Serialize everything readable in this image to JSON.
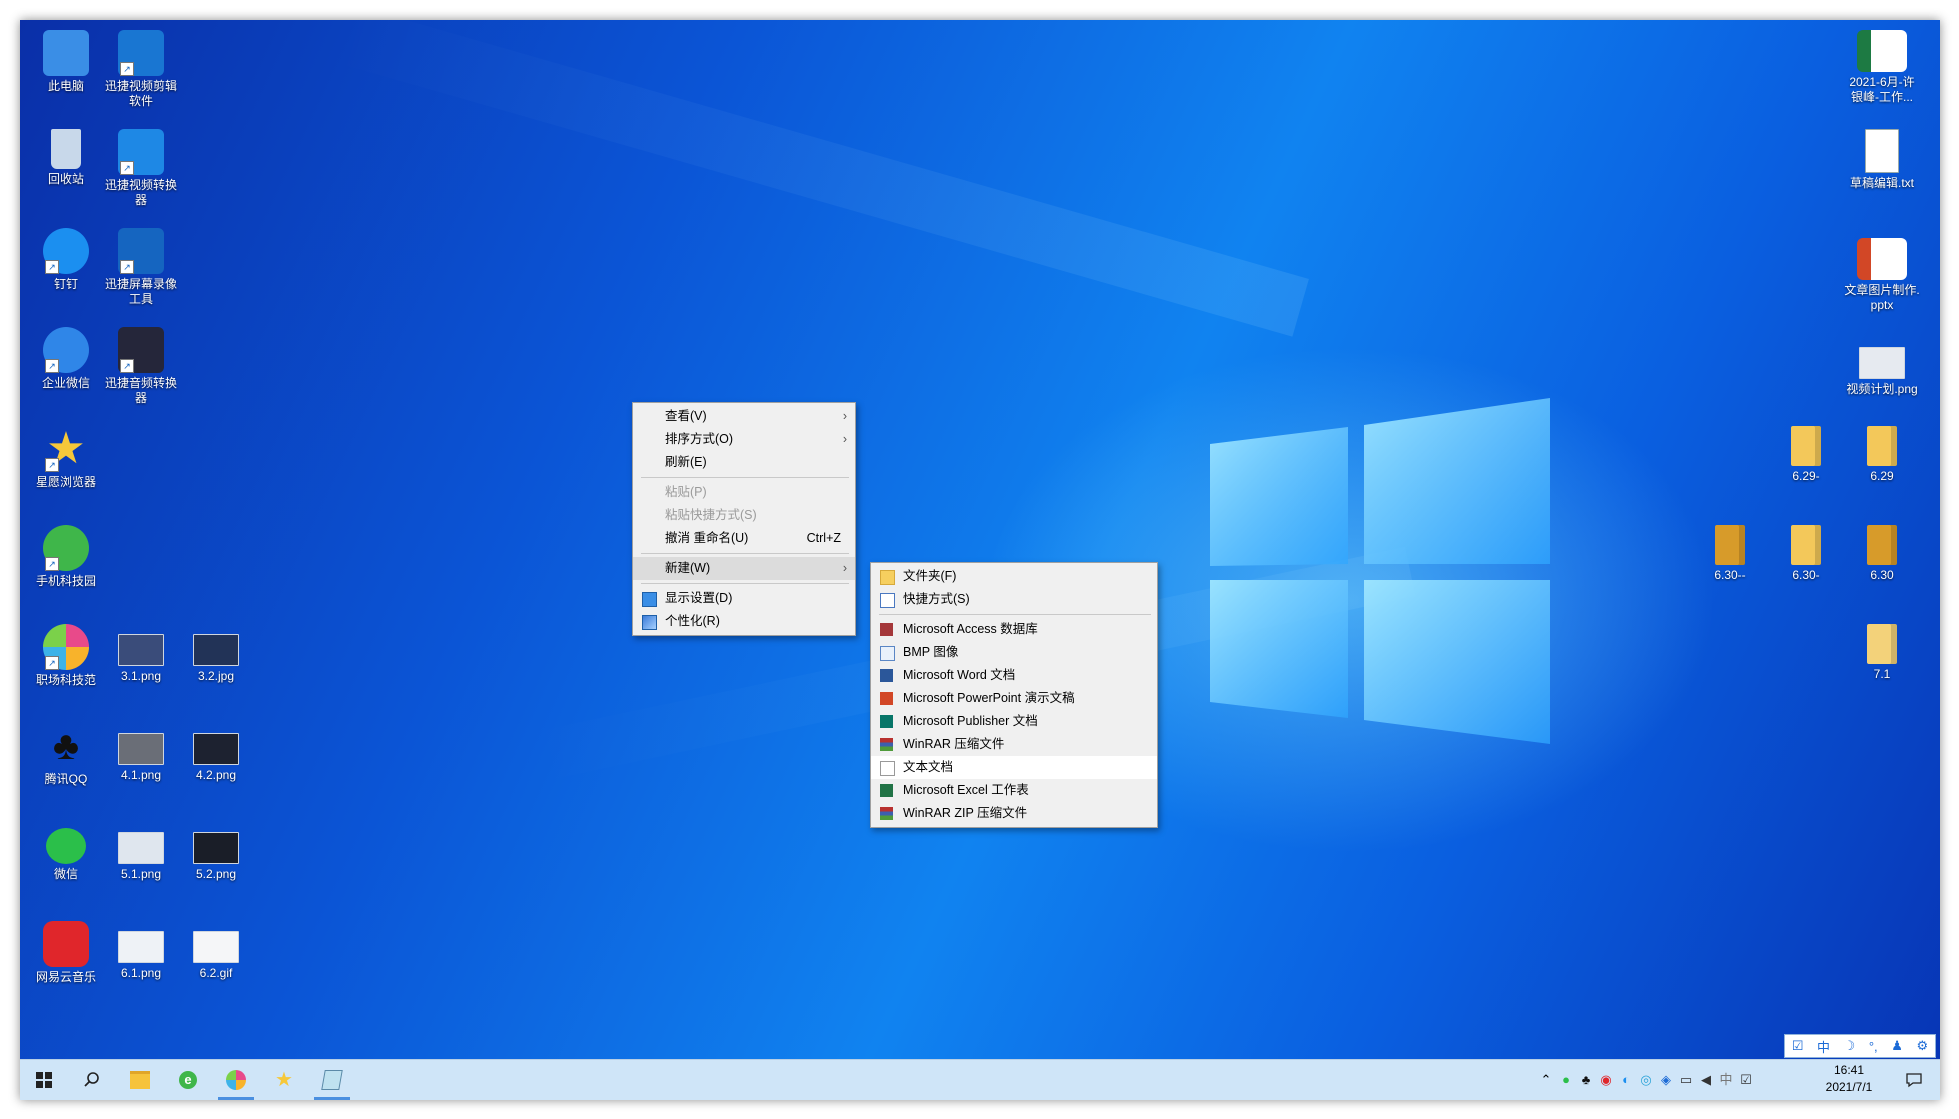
{
  "desktop": {
    "left_icons": [
      {
        "label": "此电脑",
        "icon": "this-pc-icon",
        "color": "#3a8ee6"
      },
      {
        "label": "迅捷视频剪辑软件",
        "icon": "video-editor-icon",
        "color": "#1976d2"
      },
      {
        "label": "回收站",
        "icon": "recycle-bin-icon",
        "color": "#c8d8ea"
      },
      {
        "label": "迅捷视频转换器",
        "icon": "video-converter-icon",
        "color": "#1e88e5"
      },
      {
        "label": "钉钉",
        "icon": "dingtalk-icon",
        "color": "#1b8ff0"
      },
      {
        "label": "迅捷屏幕录像工具",
        "icon": "screen-recorder-icon",
        "color": "#1565c0"
      },
      {
        "label": "企业微信",
        "icon": "wecom-icon",
        "color": "#2f86e8"
      },
      {
        "label": "迅捷音频转换器",
        "icon": "audio-converter-icon",
        "color": "#25263a"
      },
      {
        "label": "星愿浏览器",
        "icon": "twinkstar-browser-icon",
        "color": "#f6c83a"
      },
      {
        "label": "手机科技园",
        "icon": "ie-browser-icon",
        "color": "#3fb64a"
      },
      {
        "label": "职场科技范",
        "icon": "chrome-like-icon",
        "color": "#e84a8a"
      },
      {
        "label": "3.1.png",
        "icon": "image-file-icon",
        "color": "#3a4c7a"
      },
      {
        "label": "3.2.jpg",
        "icon": "image-file-icon",
        "color": "#223357"
      },
      {
        "label": "腾讯QQ",
        "icon": "qq-icon",
        "color": "#111111"
      },
      {
        "label": "4.1.png",
        "icon": "image-file-icon",
        "color": "#6a6e77"
      },
      {
        "label": "4.2.png",
        "icon": "image-file-icon",
        "color": "#1d2230"
      },
      {
        "label": "微信",
        "icon": "wechat-icon",
        "color": "#2bbf4a"
      },
      {
        "label": "5.1.png",
        "icon": "image-file-icon",
        "color": "#dfe6ee"
      },
      {
        "label": "5.2.png",
        "icon": "image-file-icon",
        "color": "#1a1e28"
      },
      {
        "label": "网易云音乐",
        "icon": "netease-music-icon",
        "color": "#e0262b"
      },
      {
        "label": "6.1.png",
        "icon": "image-file-icon",
        "color": "#eef2f6"
      },
      {
        "label": "6.2.gif",
        "icon": "image-file-icon",
        "color": "#f5f6f8"
      }
    ],
    "right_icons": [
      {
        "label": "2021-6月-许银峰-工作...",
        "icon": "excel-file-icon",
        "color": "#1d7a43"
      },
      {
        "label": "草稿编辑.txt",
        "icon": "text-file-icon",
        "color": "#ffffff"
      },
      {
        "label": "文章图片制作.pptx",
        "icon": "pptx-file-icon",
        "color": "#d24726"
      },
      {
        "label": "视频计划.png",
        "icon": "image-file-icon",
        "color": "#e6eaf0"
      },
      {
        "label": "6.29-",
        "icon": "folder-icon",
        "color": "#f3c85a"
      },
      {
        "label": "6.29",
        "icon": "folder-icon",
        "color": "#f3c85a"
      },
      {
        "label": "6.30--",
        "icon": "folder-icon",
        "color": "#d79b2a"
      },
      {
        "label": "6.30-",
        "icon": "folder-icon",
        "color": "#f3c85a"
      },
      {
        "label": "6.30",
        "icon": "folder-icon",
        "color": "#d79b2a"
      },
      {
        "label": "7.1",
        "icon": "folder-icon",
        "color": "#f3d27a"
      }
    ]
  },
  "context_menu": {
    "view": "查看(V)",
    "sort": "排序方式(O)",
    "refresh": "刷新(E)",
    "paste": "粘贴(P)",
    "paste_shortcut": "粘贴快捷方式(S)",
    "undo_rename": "撤消 重命名(U)",
    "undo_accel": "Ctrl+Z",
    "new": "新建(W)",
    "display_settings": "显示设置(D)",
    "personalize": "个性化(R)"
  },
  "new_submenu": {
    "folder": "文件夹(F)",
    "shortcut": "快捷方式(S)",
    "access": "Microsoft Access 数据库",
    "bmp": "BMP 图像",
    "word": "Microsoft Word 文档",
    "powerpoint": "Microsoft PowerPoint 演示文稿",
    "publisher": "Microsoft Publisher 文档",
    "winrar": "WinRAR 压缩文件",
    "text": "文本文档",
    "excel": "Microsoft Excel 工作表",
    "winrar_zip": "WinRAR ZIP 压缩文件"
  },
  "taskbar": {
    "clock_time": "16:41",
    "clock_date": "2021/7/1",
    "ime": "中"
  },
  "colors": {
    "accent": "#1083f0",
    "taskbar": "#cfe5f8",
    "menu_bg": "#f0f0f0"
  }
}
